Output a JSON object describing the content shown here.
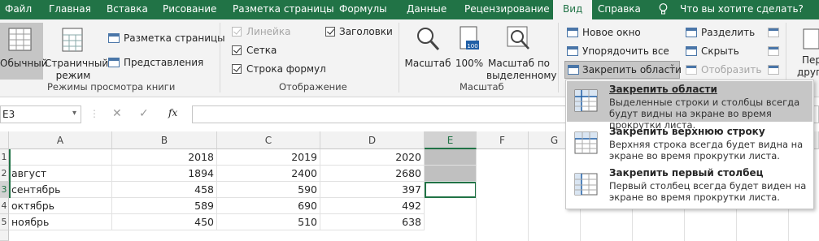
{
  "tabs": [
    "Файл",
    "Главная",
    "Вставка",
    "Рисование",
    "Разметка страницы",
    "Формулы",
    "Данные",
    "Рецензирование",
    "Вид",
    "Справка",
    "Что вы хотите сделать?"
  ],
  "ribbon": {
    "views": {
      "normal": "Обычный",
      "page_layout_a": "Страничный",
      "page_layout_b": "режим",
      "page_markup": "Разметка страницы",
      "representations": "Представления",
      "group_label": "Режимы просмотра книги"
    },
    "show": {
      "ruler": "Линейка",
      "grid": "Сетка",
      "formula_bar": "Строка формул",
      "headings": "Заголовки",
      "group_label": "Отображение",
      "ruler_checked": true,
      "grid_checked": true,
      "formula_bar_checked": true,
      "headings_checked": true
    },
    "zoom": {
      "zoom": "Масштаб",
      "hundred": "100%",
      "to_selection_a": "Масштаб по",
      "to_selection_b": "выделенному",
      "group_label": "Масштаб"
    },
    "window": {
      "new_window": "Новое окно",
      "arrange_all": "Упорядочить все",
      "freeze_panes": "Закрепить области",
      "split": "Разделить",
      "hide": "Скрыть",
      "unhide": "Отобразить",
      "cut_a": "Пер",
      "cut_b": "другого"
    }
  },
  "formula_bar": {
    "name_box": "E3",
    "fx": "fx"
  },
  "sheet": {
    "columns": [
      "A",
      "B",
      "C",
      "D",
      "E",
      "F",
      "G"
    ],
    "rows": [
      {
        "num": "1",
        "a": "",
        "b": "2018",
        "c": "2019",
        "d": "2020"
      },
      {
        "num": "2",
        "a": "август",
        "b": "1894",
        "c": "2400",
        "d": "2680"
      },
      {
        "num": "3",
        "a": "сентябрь",
        "b": "458",
        "c": "590",
        "d": "397"
      },
      {
        "num": "4",
        "a": "октябрь",
        "b": "589",
        "c": "690",
        "d": "492"
      },
      {
        "num": "5",
        "a": "ноябрь",
        "b": "450",
        "c": "510",
        "d": "638"
      }
    ]
  },
  "freeze_menu": [
    {
      "title": "Закрепить области",
      "desc": "Выделенные строки и столбцы всегда будут видны на экране во время прокрутки листа."
    },
    {
      "title": "Закрепить верхнюю строку",
      "desc": "Верхняя строка всегда будет видна на экране во время прокрутки листа."
    },
    {
      "title": "Закрепить первый столбец",
      "desc": "Первый столбец всегда будет виден на экране во время прокрутки листа."
    }
  ],
  "colors": {
    "accent": "#217346",
    "highlight": "#c6c6c6",
    "selected_cell": "#217346"
  }
}
